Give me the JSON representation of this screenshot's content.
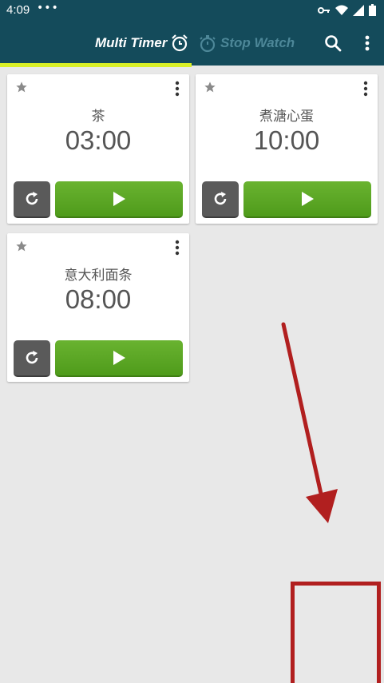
{
  "status_bar": {
    "time": "4:09",
    "notification_dots": "•••"
  },
  "app_bar": {
    "tab_multi_timer": "Multi Timer",
    "tab_stop_watch": "Stop Watch",
    "accent_color": "#d9ef27",
    "background_color": "#144b5b"
  },
  "timers": [
    {
      "name": "茶",
      "time": "03:00"
    },
    {
      "name": "煮溏心蛋",
      "time": "10:00"
    },
    {
      "name": "意大利面条",
      "time": "08:00"
    }
  ],
  "colors": {
    "play_button": "#5aa624",
    "reset_button": "#5a5a5a",
    "annotation_arrow": "#b11f1f"
  },
  "icons": {
    "star": "star-icon",
    "more": "more-vert-icon",
    "reset": "reset-icon",
    "play": "play-icon",
    "search": "search-icon",
    "alarm": "alarm-clock-icon",
    "stopwatch": "stopwatch-icon"
  }
}
